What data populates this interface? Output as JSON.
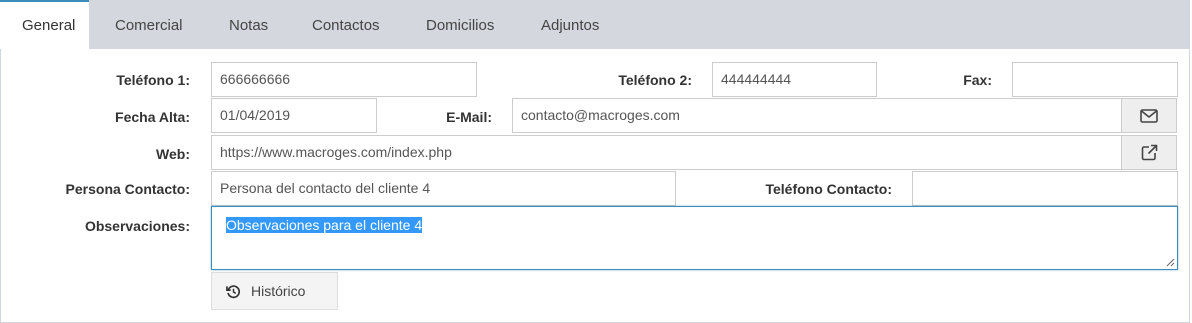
{
  "tabs": [
    {
      "label": "General",
      "active": true
    },
    {
      "label": "Comercial",
      "active": false
    },
    {
      "label": "Notas",
      "active": false
    },
    {
      "label": "Contactos",
      "active": false
    },
    {
      "label": "Domicilios",
      "active": false
    },
    {
      "label": "Adjuntos",
      "active": false
    }
  ],
  "form": {
    "telefono1": {
      "label": "Teléfono 1:",
      "value": "666666666"
    },
    "telefono2": {
      "label": "Teléfono 2:",
      "value": "444444444"
    },
    "fax": {
      "label": "Fax:",
      "value": ""
    },
    "fecha_alta": {
      "label": "Fecha Alta:",
      "value": "01/04/2019"
    },
    "email": {
      "label": "E-Mail:",
      "value": "contacto@macroges.com",
      "button_icon": "envelope-icon"
    },
    "web": {
      "label": "Web:",
      "value": "https://www.macroges.com/index.php",
      "button_icon": "external-link-icon"
    },
    "persona_contacto": {
      "label": "Persona Contacto:",
      "value": "Persona del contacto del cliente 4"
    },
    "telefono_contacto": {
      "label": "Teléfono Contacto:",
      "value": ""
    },
    "observaciones": {
      "label": "Observaciones:",
      "value": "Observaciones para el cliente 4"
    }
  },
  "historico_button": {
    "label": "Histórico",
    "icon": "history-icon"
  },
  "colors": {
    "accent": "#3c8dbc",
    "selection": "#3399ff",
    "tabbar": "#d4d7de"
  }
}
